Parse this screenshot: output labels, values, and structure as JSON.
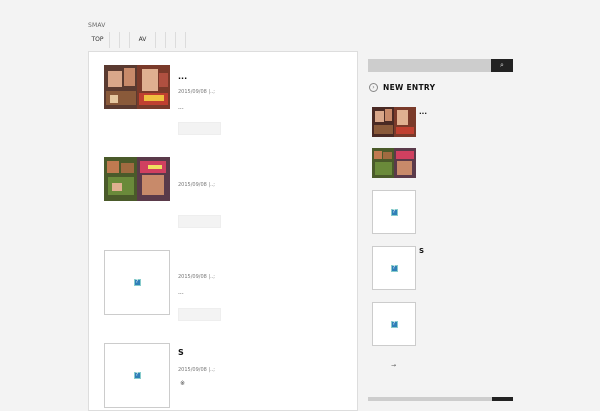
{
  "site": {
    "title": "SMAV"
  },
  "nav": {
    "items": [
      "TOP",
      "",
      "",
      "AV",
      "",
      "",
      ""
    ]
  },
  "posts": [
    {
      "title": "...",
      "date": "2015/09/08",
      "category": "|..;",
      "excerpt": "..."
    },
    {
      "title": "",
      "date": "2015/09/08",
      "category": "|..;",
      "excerpt": ""
    },
    {
      "title": "",
      "date": "2015/09/08",
      "category": "|..;",
      "excerpt": "..."
    },
    {
      "title": "S",
      "date": "2015/09/08",
      "category": "|..;",
      "excerpt": "※"
    }
  ],
  "sidebar": {
    "search_icon": "search-icon",
    "new_entry_title": "NEW ENTRY",
    "new_entry_icon": "circle-arrow-icon",
    "entries": [
      {
        "title": "..."
      },
      {
        "title": ""
      },
      {
        "title": ""
      },
      {
        "title": "S"
      },
      {
        "title": ""
      }
    ],
    "more_arrow": "→"
  },
  "placeholder_glyph": "?",
  "colors": {
    "background": "#f3f3f3",
    "search_button": "#222222",
    "search_field": "#cdcdcd",
    "placeholder_icon": "#2f7fb8"
  }
}
